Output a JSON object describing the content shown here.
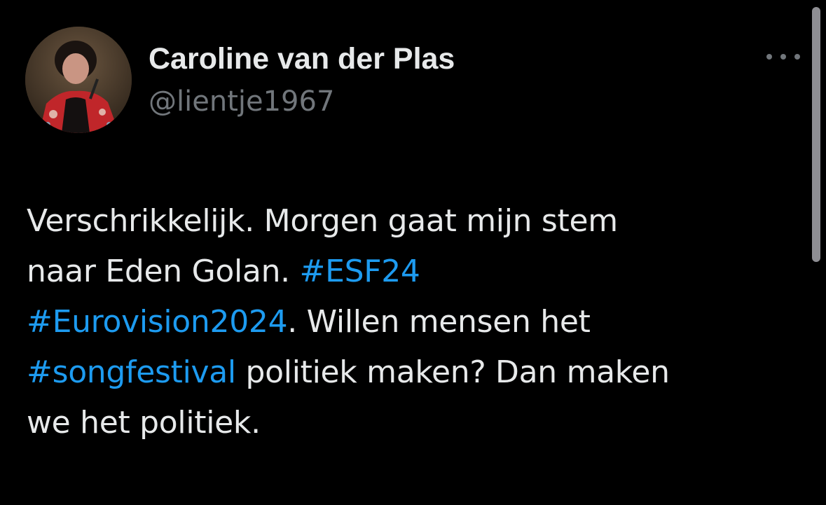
{
  "author": {
    "display_name": "Caroline van der Plas",
    "handle": "@lientje1967"
  },
  "more_icon": "more-horizontal-icon",
  "colors": {
    "background": "#000000",
    "text": "#e7e9ea",
    "secondary": "#71767b",
    "link": "#1d9bf0"
  },
  "tweet": {
    "line1": "Verschrikkelijk. Morgen gaat mijn stem",
    "line2_text": "naar Eden Golan. ",
    "hashtag_esf24": "#ESF24",
    "hashtag_eurovision": "#Eurovision2024",
    "line3_text": ". Willen mensen het",
    "hashtag_songfestival": "#songfestival",
    "line4_text": " politiek maken? Dan maken",
    "line5": "we het politiek."
  }
}
